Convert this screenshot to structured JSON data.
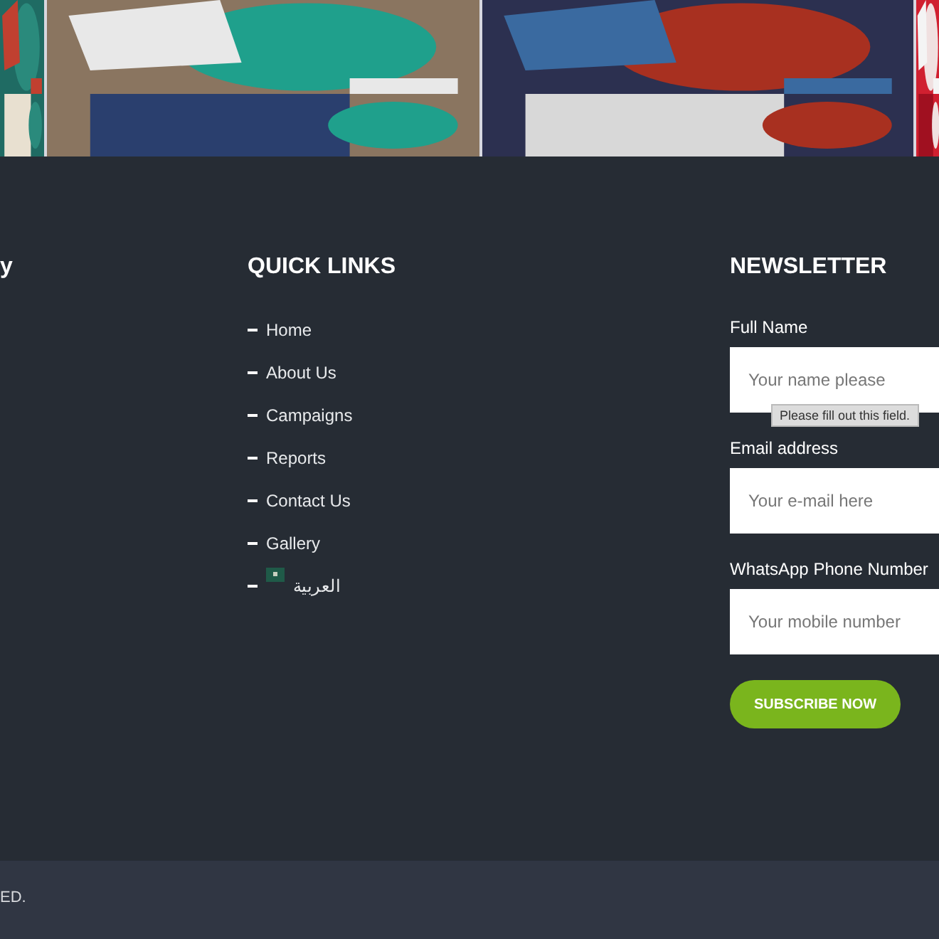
{
  "about_column": {
    "heading": "y"
  },
  "quick_links": {
    "heading": "QUICK LINKS",
    "items": [
      {
        "kind": "text",
        "label": "Home"
      },
      {
        "kind": "text",
        "label": "About Us"
      },
      {
        "kind": "text",
        "label": "Campaigns"
      },
      {
        "kind": "text",
        "label": "Reports"
      },
      {
        "kind": "text",
        "label": "Contact Us"
      },
      {
        "kind": "text",
        "label": "Gallery"
      },
      {
        "kind": "language",
        "label": "العربية"
      }
    ]
  },
  "newsletter": {
    "heading": "NEWSLETTER",
    "fields": [
      {
        "label": "Full Name",
        "placeholder": "Your name please",
        "tooltip": "Please fill out this field."
      },
      {
        "label": "Email address",
        "placeholder": "Your e-mail here"
      },
      {
        "label": "WhatsApp Phone Number",
        "placeholder": "Your mobile number"
      }
    ],
    "button": "SUBSCRIBE NOW"
  },
  "copyright": "ED."
}
